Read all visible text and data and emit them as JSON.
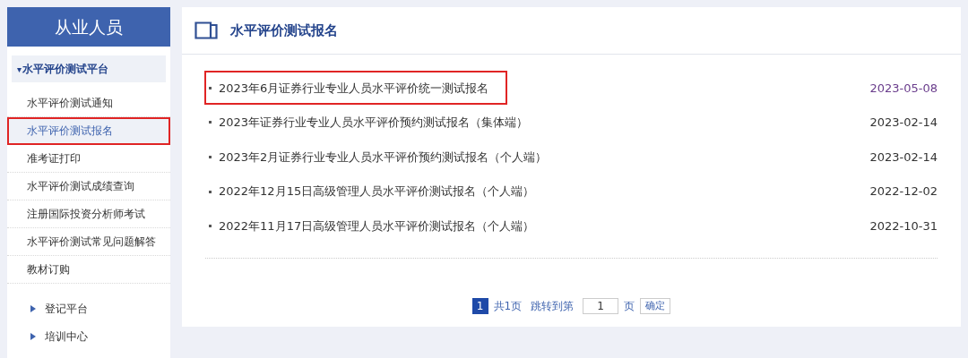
{
  "sidebar": {
    "title": "从业人员",
    "section": {
      "label": "水平评价测试平台",
      "expanded": true,
      "caret": "▾"
    },
    "items": [
      {
        "label": "水平评价测试通知",
        "selected": false,
        "highlighted": false
      },
      {
        "label": "水平评价测试报名",
        "selected": true,
        "highlighted": true
      },
      {
        "label": "准考证打印",
        "selected": false,
        "highlighted": false
      },
      {
        "label": "水平评价测试成绩查询",
        "selected": false,
        "highlighted": false
      },
      {
        "label": "注册国际投资分析师考试",
        "selected": false,
        "highlighted": false
      },
      {
        "label": "水平评价测试常见问题解答",
        "selected": false,
        "highlighted": false
      },
      {
        "label": "教材订购",
        "selected": false,
        "highlighted": false
      }
    ],
    "groups": [
      {
        "label": "登记平台",
        "expanded": false
      },
      {
        "label": "培训中心",
        "expanded": false
      }
    ]
  },
  "main": {
    "title": "水平评价测试报名",
    "news": [
      {
        "title": "2023年6月证券行业专业人员水平评价统一测试报名",
        "date": "2023-05-08",
        "visited": true,
        "highlighted": true
      },
      {
        "title": "2023年证券行业专业人员水平评价预约测试报名（集体端）",
        "date": "2023-02-14",
        "visited": false,
        "highlighted": false
      },
      {
        "title": "2023年2月证券行业专业人员水平评价预约测试报名（个人端）",
        "date": "2023-02-14",
        "visited": false,
        "highlighted": false
      },
      {
        "title": "2022年12月15日高级管理人员水平评价测试报名（个人端）",
        "date": "2022-12-02",
        "visited": false,
        "highlighted": false
      },
      {
        "title": "2022年11月17日高级管理人员水平评价测试报名（个人端）",
        "date": "2022-10-31",
        "visited": false,
        "highlighted": false
      }
    ],
    "pagination": {
      "pages": [
        {
          "label": "1",
          "selected": true
        }
      ],
      "total": "共1页",
      "jump_label": "跳转到第",
      "page_value": "1",
      "page_unit": "页",
      "confirm": "确定"
    }
  }
}
